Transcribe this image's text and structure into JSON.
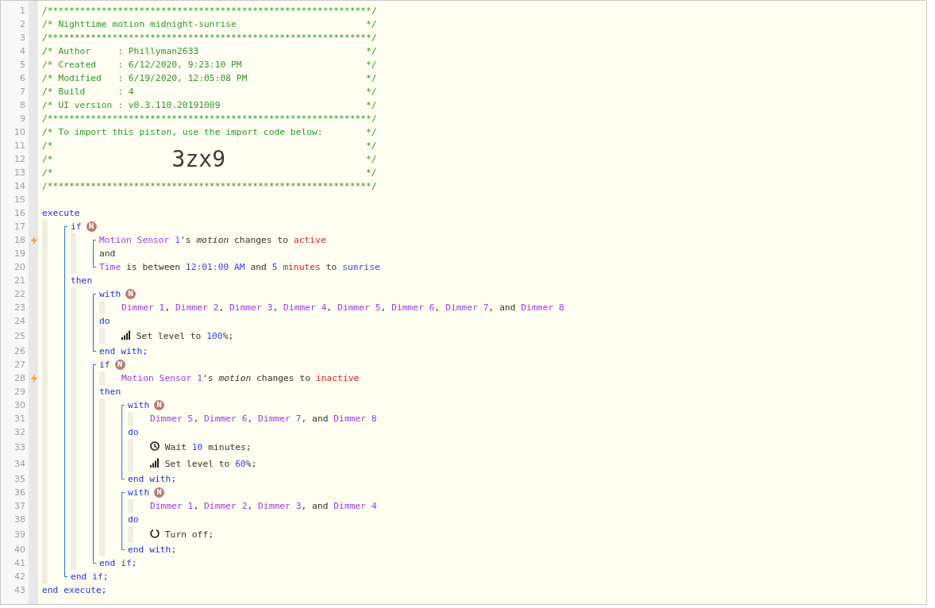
{
  "header": [
    {
      "n": "1",
      "segs": [
        {
          "kind": "comment",
          "t": "/************************************************************/"
        }
      ]
    },
    {
      "n": "2",
      "segs": [
        {
          "kind": "comment",
          "t": "/* Nighttime motion midnight-sunrise"
        },
        {
          "kind": "comment-end",
          "t": "*/"
        }
      ]
    },
    {
      "n": "3",
      "segs": [
        {
          "kind": "comment",
          "t": "/************************************************************/"
        }
      ]
    },
    {
      "n": "4",
      "segs": [
        {
          "kind": "comment",
          "t": "/* Author     : Phillyman2633"
        },
        {
          "kind": "comment-end",
          "t": "*/"
        }
      ]
    },
    {
      "n": "5",
      "segs": [
        {
          "kind": "comment",
          "t": "/* Created    : 6/12/2020, 9:23:10 PM"
        },
        {
          "kind": "comment-end",
          "t": "*/"
        }
      ]
    },
    {
      "n": "6",
      "segs": [
        {
          "kind": "comment",
          "t": "/* Modified   : 6/19/2020, 12:05:08 PM"
        },
        {
          "kind": "comment-end",
          "t": "*/"
        }
      ]
    },
    {
      "n": "7",
      "segs": [
        {
          "kind": "comment",
          "t": "/* Build      : 4"
        },
        {
          "kind": "comment-end",
          "t": "*/"
        }
      ]
    },
    {
      "n": "8",
      "segs": [
        {
          "kind": "comment",
          "t": "/* UI version : v0.3.110.20191009"
        },
        {
          "kind": "comment-end",
          "t": "*/"
        }
      ]
    },
    {
      "n": "9",
      "segs": [
        {
          "kind": "comment",
          "t": "/************************************************************/"
        }
      ]
    },
    {
      "n": "10",
      "segs": [
        {
          "kind": "comment",
          "t": "/* To import this piston, use the import code below:"
        },
        {
          "kind": "comment-end",
          "t": "*/"
        }
      ]
    },
    {
      "n": "11",
      "segs": [
        {
          "kind": "comment",
          "t": "/*"
        },
        {
          "kind": "comment-end",
          "t": "*/"
        }
      ]
    },
    {
      "n": "12",
      "segs": [
        {
          "kind": "comment",
          "t": "/*"
        },
        {
          "kind": "import-code",
          "t": "3zx9"
        },
        {
          "kind": "comment-end",
          "t": "*/"
        }
      ]
    },
    {
      "n": "13",
      "segs": [
        {
          "kind": "comment",
          "t": "/*"
        },
        {
          "kind": "comment-end",
          "t": "*/"
        }
      ]
    },
    {
      "n": "14",
      "segs": [
        {
          "kind": "comment",
          "t": "/************************************************************/"
        }
      ]
    },
    {
      "n": "15"
    }
  ],
  "body": [
    {
      "kind": "line",
      "n": "16",
      "trigger": false,
      "segs": [
        {
          "kind": "keyword",
          "t": "execute"
        }
      ]
    },
    {
      "kind": "group",
      "children": [
        {
          "kind": "bracket",
          "children": [
            {
              "kind": "line",
              "n": "17",
              "trigger": false,
              "segs": [
                {
                  "kind": "keyword",
                  "t": "if"
                },
                {
                  "kind": "badge",
                  "t": "N"
                }
              ]
            },
            {
              "kind": "group",
              "children": [
                {
                  "kind": "bracket",
                  "children": [
                    {
                      "kind": "line",
                      "n": "18",
                      "trigger": true,
                      "segs": [
                        {
                          "kind": "device",
                          "t": "Motion Sensor 1"
                        },
                        {
                          "kind": "plain",
                          "t": "'s "
                        },
                        {
                          "kind": "attribute",
                          "t": "motion"
                        },
                        {
                          "kind": "plain",
                          "t": " changes to "
                        },
                        {
                          "kind": "value",
                          "t": "active"
                        }
                      ]
                    },
                    {
                      "kind": "line",
                      "n": "19",
                      "trigger": false,
                      "segs": [
                        {
                          "kind": "plain",
                          "t": "and"
                        }
                      ]
                    },
                    {
                      "kind": "line",
                      "n": "20",
                      "trigger": false,
                      "segs": [
                        {
                          "kind": "device",
                          "t": "Time"
                        },
                        {
                          "kind": "plain",
                          "t": " is between "
                        },
                        {
                          "kind": "number",
                          "t": "12:01:00 AM"
                        },
                        {
                          "kind": "plain",
                          "t": " and "
                        },
                        {
                          "kind": "number",
                          "t": "5"
                        },
                        {
                          "kind": "value",
                          "t": " minutes"
                        },
                        {
                          "kind": "plain",
                          "t": " to "
                        },
                        {
                          "kind": "number",
                          "t": "sunrise"
                        }
                      ]
                    }
                  ]
                }
              ]
            },
            {
              "kind": "line",
              "n": "21",
              "trigger": false,
              "segs": [
                {
                  "kind": "keyword",
                  "t": "then"
                }
              ]
            },
            {
              "kind": "group",
              "children": [
                {
                  "kind": "bracket",
                  "children": [
                    {
                      "kind": "line",
                      "n": "22",
                      "trigger": false,
                      "segs": [
                        {
                          "kind": "keyword",
                          "t": "with"
                        },
                        {
                          "kind": "badge",
                          "t": "N"
                        }
                      ]
                    },
                    {
                      "kind": "group",
                      "children": [
                        {
                          "kind": "line",
                          "n": "23",
                          "trigger": false,
                          "segs": [
                            {
                              "kind": "device",
                              "t": "Dimmer 1"
                            },
                            {
                              "kind": "plain",
                              "t": ", "
                            },
                            {
                              "kind": "device",
                              "t": "Dimmer 2"
                            },
                            {
                              "kind": "plain",
                              "t": ", "
                            },
                            {
                              "kind": "device",
                              "t": "Dimmer 3"
                            },
                            {
                              "kind": "plain",
                              "t": ", "
                            },
                            {
                              "kind": "device",
                              "t": "Dimmer 4"
                            },
                            {
                              "kind": "plain",
                              "t": ", "
                            },
                            {
                              "kind": "device",
                              "t": "Dimmer 5"
                            },
                            {
                              "kind": "plain",
                              "t": ", "
                            },
                            {
                              "kind": "device",
                              "t": "Dimmer 6"
                            },
                            {
                              "kind": "plain",
                              "t": ", "
                            },
                            {
                              "kind": "device",
                              "t": "Dimmer 7"
                            },
                            {
                              "kind": "plain",
                              "t": ", and "
                            },
                            {
                              "kind": "device",
                              "t": "Dimmer 8"
                            }
                          ]
                        }
                      ]
                    },
                    {
                      "kind": "line",
                      "n": "24",
                      "trigger": false,
                      "segs": [
                        {
                          "kind": "keyword",
                          "t": "do"
                        }
                      ]
                    },
                    {
                      "kind": "group",
                      "children": [
                        {
                          "kind": "line",
                          "n": "25",
                          "trigger": false,
                          "segs": [
                            {
                              "kind": "level-icon"
                            },
                            {
                              "kind": "plain",
                              "t": " Set level to "
                            },
                            {
                              "kind": "number",
                              "t": "100"
                            },
                            {
                              "kind": "plain",
                              "t": "%;"
                            }
                          ]
                        }
                      ]
                    },
                    {
                      "kind": "line",
                      "n": "26",
                      "trigger": false,
                      "segs": [
                        {
                          "kind": "keyword",
                          "t": "end with;"
                        }
                      ]
                    }
                  ]
                },
                {
                  "kind": "bracket",
                  "children": [
                    {
                      "kind": "line",
                      "n": "27",
                      "trigger": false,
                      "segs": [
                        {
                          "kind": "keyword",
                          "t": "if"
                        },
                        {
                          "kind": "badge",
                          "t": "N"
                        }
                      ]
                    },
                    {
                      "kind": "group",
                      "children": [
                        {
                          "kind": "line",
                          "n": "28",
                          "trigger": true,
                          "segs": [
                            {
                              "kind": "device",
                              "t": "Motion Sensor 1"
                            },
                            {
                              "kind": "plain",
                              "t": "'s "
                            },
                            {
                              "kind": "attribute",
                              "t": "motion"
                            },
                            {
                              "kind": "plain",
                              "t": " changes to "
                            },
                            {
                              "kind": "value",
                              "t": "inactive"
                            }
                          ]
                        }
                      ]
                    },
                    {
                      "kind": "line",
                      "n": "29",
                      "trigger": false,
                      "segs": [
                        {
                          "kind": "keyword",
                          "t": "then"
                        }
                      ]
                    },
                    {
                      "kind": "group",
                      "children": [
                        {
                          "kind": "bracket",
                          "children": [
                            {
                              "kind": "line",
                              "n": "30",
                              "trigger": false,
                              "segs": [
                                {
                                  "kind": "keyword",
                                  "t": "with"
                                },
                                {
                                  "kind": "badge",
                                  "t": "N"
                                }
                              ]
                            },
                            {
                              "kind": "group",
                              "children": [
                                {
                                  "kind": "line",
                                  "n": "31",
                                  "trigger": false,
                                  "segs": [
                                    {
                                      "kind": "device",
                                      "t": "Dimmer 5"
                                    },
                                    {
                                      "kind": "plain",
                                      "t": ", "
                                    },
                                    {
                                      "kind": "device",
                                      "t": "Dimmer 6"
                                    },
                                    {
                                      "kind": "plain",
                                      "t": ", "
                                    },
                                    {
                                      "kind": "device",
                                      "t": "Dimmer 7"
                                    },
                                    {
                                      "kind": "plain",
                                      "t": ", and "
                                    },
                                    {
                                      "kind": "device",
                                      "t": "Dimmer 8"
                                    }
                                  ]
                                }
                              ]
                            },
                            {
                              "kind": "line",
                              "n": "32",
                              "trigger": false,
                              "segs": [
                                {
                                  "kind": "keyword",
                                  "t": "do"
                                }
                              ]
                            },
                            {
                              "kind": "group",
                              "children": [
                                {
                                  "kind": "line",
                                  "n": "33",
                                  "trigger": false,
                                  "segs": [
                                    {
                                      "kind": "clock-icon"
                                    },
                                    {
                                      "kind": "plain",
                                      "t": " Wait "
                                    },
                                    {
                                      "kind": "number",
                                      "t": "10"
                                    },
                                    {
                                      "kind": "plain",
                                      "t": " minutes;"
                                    }
                                  ]
                                },
                                {
                                  "kind": "line",
                                  "n": "34",
                                  "trigger": false,
                                  "segs": [
                                    {
                                      "kind": "level-icon"
                                    },
                                    {
                                      "kind": "plain",
                                      "t": " Set level to "
                                    },
                                    {
                                      "kind": "number",
                                      "t": "60"
                                    },
                                    {
                                      "kind": "plain",
                                      "t": "%;"
                                    }
                                  ]
                                }
                              ]
                            },
                            {
                              "kind": "line",
                              "n": "35",
                              "trigger": false,
                              "segs": [
                                {
                                  "kind": "keyword",
                                  "t": "end with;"
                                }
                              ]
                            }
                          ]
                        },
                        {
                          "kind": "bracket",
                          "children": [
                            {
                              "kind": "line",
                              "n": "36",
                              "trigger": false,
                              "segs": [
                                {
                                  "kind": "keyword",
                                  "t": "with"
                                },
                                {
                                  "kind": "badge",
                                  "t": "N"
                                }
                              ]
                            },
                            {
                              "kind": "group",
                              "children": [
                                {
                                  "kind": "line",
                                  "n": "37",
                                  "trigger": false,
                                  "segs": [
                                    {
                                      "kind": "device",
                                      "t": "Dimmer 1"
                                    },
                                    {
                                      "kind": "plain",
                                      "t": ", "
                                    },
                                    {
                                      "kind": "device",
                                      "t": "Dimmer 2"
                                    },
                                    {
                                      "kind": "plain",
                                      "t": ", "
                                    },
                                    {
                                      "kind": "device",
                                      "t": "Dimmer 3"
                                    },
                                    {
                                      "kind": "plain",
                                      "t": ", and "
                                    },
                                    {
                                      "kind": "device",
                                      "t": "Dimmer 4"
                                    }
                                  ]
                                }
                              ]
                            },
                            {
                              "kind": "line",
                              "n": "38",
                              "trigger": false,
                              "segs": [
                                {
                                  "kind": "keyword",
                                  "t": "do"
                                }
                              ]
                            },
                            {
                              "kind": "group",
                              "children": [
                                {
                                  "kind": "line",
                                  "n": "39",
                                  "trigger": false,
                                  "segs": [
                                    {
                                      "kind": "power-icon"
                                    },
                                    {
                                      "kind": "plain",
                                      "t": " Turn off;"
                                    }
                                  ]
                                }
                              ]
                            },
                            {
                              "kind": "line",
                              "n": "40",
                              "trigger": false,
                              "segs": [
                                {
                                  "kind": "keyword",
                                  "t": "end with;"
                                }
                              ]
                            }
                          ]
                        }
                      ]
                    },
                    {
                      "kind": "line",
                      "n": "41",
                      "trigger": false,
                      "segs": [
                        {
                          "kind": "keyword",
                          "t": "end if;"
                        }
                      ]
                    }
                  ]
                }
              ]
            },
            {
              "kind": "line",
              "n": "42",
              "trigger": false,
              "segs": [
                {
                  "kind": "keyword",
                  "t": "end if;"
                }
              ]
            }
          ]
        }
      ]
    },
    {
      "kind": "line",
      "n": "43",
      "trigger": false,
      "segs": [
        {
          "kind": "keyword",
          "t": "end execute;"
        }
      ]
    }
  ]
}
